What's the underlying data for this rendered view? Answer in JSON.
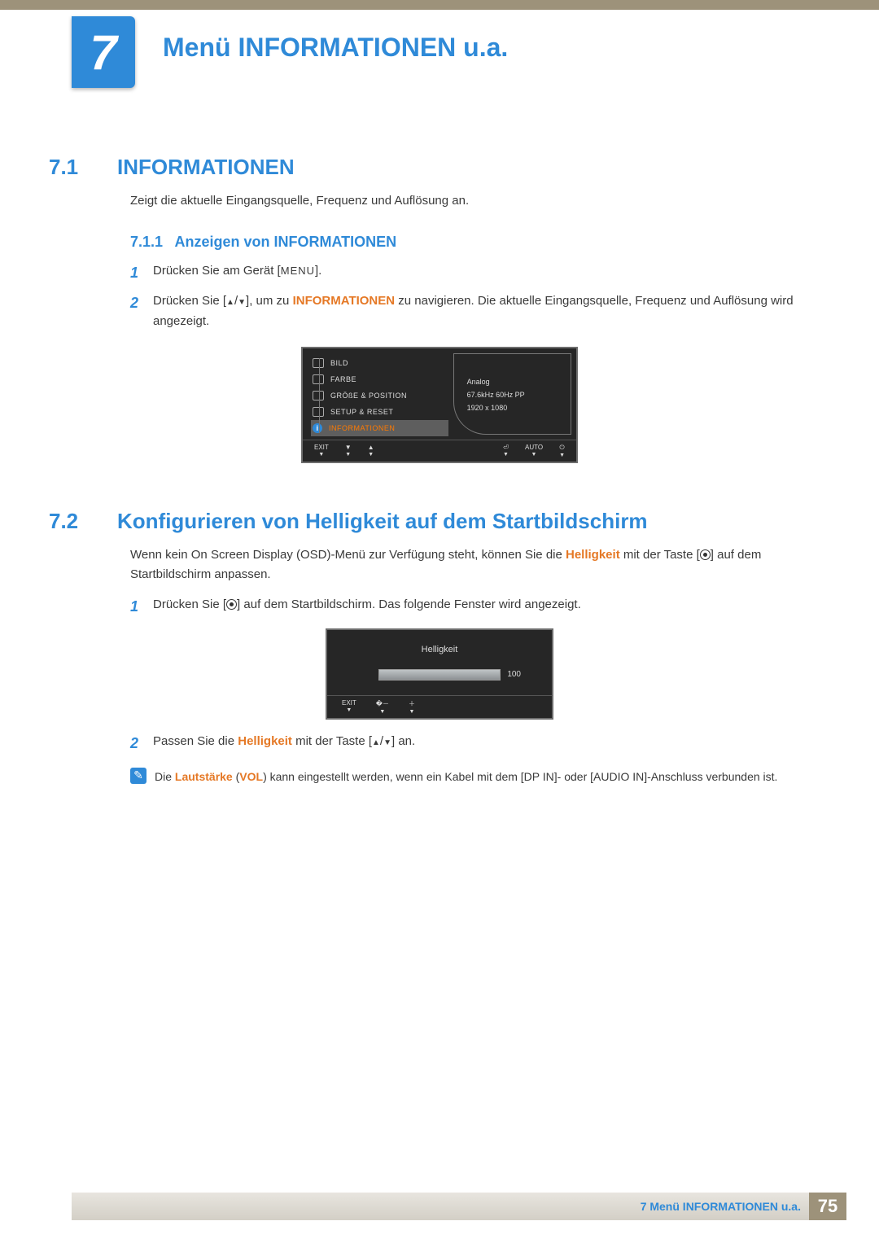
{
  "chapter": {
    "number": "7",
    "title": "Menü INFORMATIONEN u.a."
  },
  "s71": {
    "num": "7.1",
    "title": "INFORMATIONEN",
    "intro": "Zeigt die aktuelle Eingangsquelle, Frequenz und Auflösung an.",
    "sub_num": "7.1.1",
    "sub_title": "Anzeigen von INFORMATIONEN",
    "step1_a": "Drücken Sie am Gerät [",
    "step1_menu": "MENU",
    "step1_b": "].",
    "step2_a": "Drücken Sie [",
    "step2_b": "], um zu ",
    "step2_inf": "INFORMATIONEN",
    "step2_c": " zu navigieren. Die aktuelle Eingangsquelle, Frequenz und Auflösung wird angezeigt."
  },
  "osd1": {
    "items": [
      "BILD",
      "FARBE",
      "GRÖßE & POSITION",
      "SETUP & RESET",
      "INFORMATIONEN"
    ],
    "info": {
      "l1": "Analog",
      "l2": "67.6kHz 60Hz PP",
      "l3": "1920 x 1080"
    },
    "foot": {
      "exit": "EXIT",
      "auto": "AUTO"
    }
  },
  "s72": {
    "num": "7.2",
    "title": "Konfigurieren von Helligkeit auf dem Startbildschirm",
    "p_a": "Wenn kein On Screen Display (OSD)-Menü zur Verfügung steht, können Sie die ",
    "p_h": "Helligkeit",
    "p_b": " mit der Taste [",
    "p_c": "] auf dem Startbildschirm anpassen.",
    "step1_a": "Drücken Sie [",
    "step1_b": "] auf dem Startbildschirm. Das folgende Fenster wird angezeigt.",
    "step2_a": "Passen Sie die ",
    "step2_h": "Helligkeit",
    "step2_b": " mit der Taste [",
    "step2_c": "] an."
  },
  "osd2": {
    "title": "Helligkeit",
    "value": "100",
    "exit": "EXIT"
  },
  "note": {
    "a": "Die ",
    "laut": "Lautstärke",
    "b": " (",
    "vol": "VOL",
    "c": ") kann eingestellt werden, wenn ein Kabel mit dem [DP IN]- oder [AUDIO IN]-Anschluss verbunden ist."
  },
  "footer": {
    "text": "7 Menü INFORMATIONEN u.a.",
    "page": "75"
  }
}
